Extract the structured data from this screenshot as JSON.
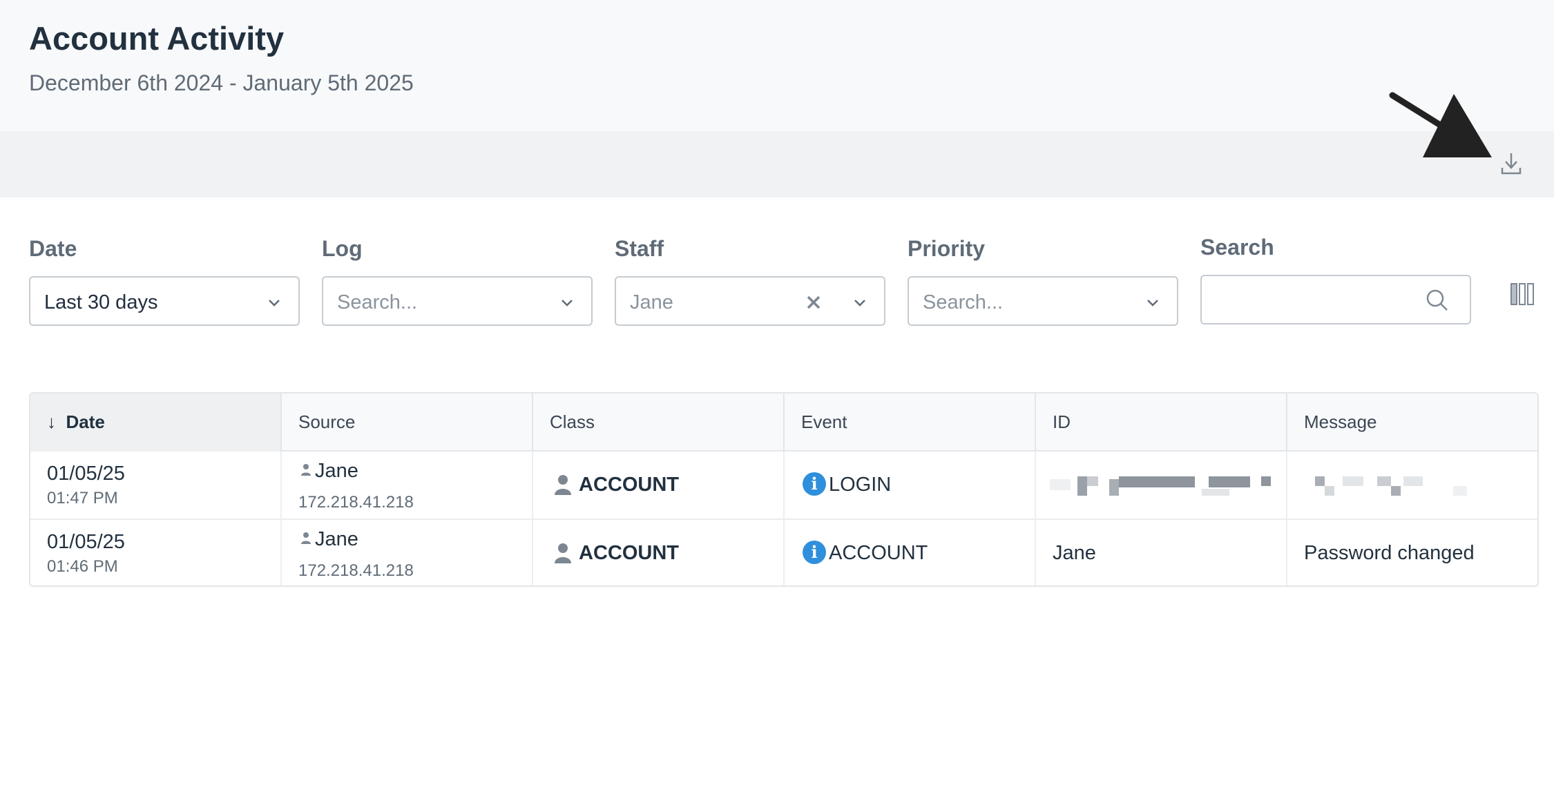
{
  "header": {
    "title": "Account Activity",
    "subtitle": "December 6th 2024 - January 5th 2025"
  },
  "toolbar": {
    "download_icon": "download-icon"
  },
  "filters": {
    "date": {
      "label": "Date",
      "value": "Last 30 days"
    },
    "log": {
      "label": "Log",
      "placeholder": "Search..."
    },
    "staff": {
      "label": "Staff",
      "value": "Jane"
    },
    "priority": {
      "label": "Priority",
      "placeholder": "Search..."
    },
    "search": {
      "label": "Search",
      "value": ""
    }
  },
  "table": {
    "columns": [
      "Date",
      "Source",
      "Class",
      "Event",
      "ID",
      "Message"
    ],
    "sort_indicator": "↓",
    "rows": [
      {
        "date": "01/05/25",
        "time": "01:47 PM",
        "source_name": "Jane",
        "source_ip": "172.218.41.218",
        "class": "ACCOUNT",
        "event": "LOGIN",
        "id": "",
        "message": ""
      },
      {
        "date": "01/05/25",
        "time": "01:46 PM",
        "source_name": "Jane",
        "source_ip": "172.218.41.218",
        "class": "ACCOUNT",
        "event": "ACCOUNT",
        "id": "Jane",
        "message": "Password changed"
      }
    ]
  },
  "colors": {
    "accent": "#2f8fdc",
    "header_bg": "#f8f9fa",
    "toolbar_bg": "#f1f2f4",
    "text": "#22313f",
    "muted": "#5f6b77"
  }
}
